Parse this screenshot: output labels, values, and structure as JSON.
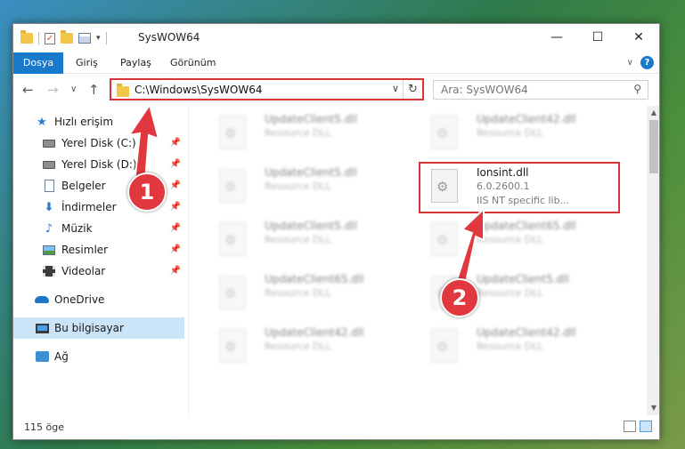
{
  "window": {
    "title": "SysWOW64",
    "controls": {
      "minimize": "—",
      "maximize": "☐",
      "close": "✕"
    }
  },
  "ribbon": {
    "tabs": [
      "Dosya",
      "Giriş",
      "Paylaş",
      "Görünüm"
    ]
  },
  "address": {
    "path": "C:\\Windows\\SysWOW64"
  },
  "search": {
    "placeholder": "Ara: SysWOW64"
  },
  "sidebar": {
    "items": [
      {
        "label": "Hızlı erişim",
        "icon": "star-icon"
      },
      {
        "label": "Yerel Disk (C:)",
        "icon": "disk-icon"
      },
      {
        "label": "Yerel Disk (D:)",
        "icon": "disk-icon"
      },
      {
        "label": "Belgeler",
        "icon": "documents-icon"
      },
      {
        "label": "İndirmeler",
        "icon": "downloads-icon"
      },
      {
        "label": "Müzik",
        "icon": "music-icon"
      },
      {
        "label": "Resimler",
        "icon": "pictures-icon"
      },
      {
        "label": "Videolar",
        "icon": "videos-icon"
      },
      {
        "label": "OneDrive",
        "icon": "onedrive-icon"
      },
      {
        "label": "Bu bilgisayar",
        "icon": "this-pc-icon"
      },
      {
        "label": "Ağ",
        "icon": "network-icon"
      }
    ]
  },
  "files": [
    {
      "name": "UpdateClient5.dll",
      "sub": "Resource DLL"
    },
    {
      "name": "UpdateClient42.dll",
      "sub": "Resource DLL"
    },
    {
      "name": "UpdateClient5.dll",
      "sub": "Resource DLL"
    },
    {
      "name": "Ionsint.dll",
      "sub": "6.0.2600.1",
      "sub2": "IIS NT specific lib..."
    },
    {
      "name": "UpdateClient5.dll",
      "sub": "Resource DLL"
    },
    {
      "name": "UpdateClient65.dll",
      "sub": "Resource DLL"
    },
    {
      "name": "UpdateClient65.dll",
      "sub": "Resource DLL"
    },
    {
      "name": "UpdateClient5.dll",
      "sub": "Resource DLL"
    },
    {
      "name": "UpdateClient42.dll",
      "sub": "Resource DLL"
    },
    {
      "name": "UpdateClient42.dll",
      "sub": "Resource DLL"
    }
  ],
  "status": {
    "count": "115 öge"
  },
  "annotations": {
    "step1": "1",
    "step2": "2"
  },
  "colors": {
    "accent": "#1979ca",
    "highlight": "#d9343a",
    "selected": "#cce4f7"
  }
}
